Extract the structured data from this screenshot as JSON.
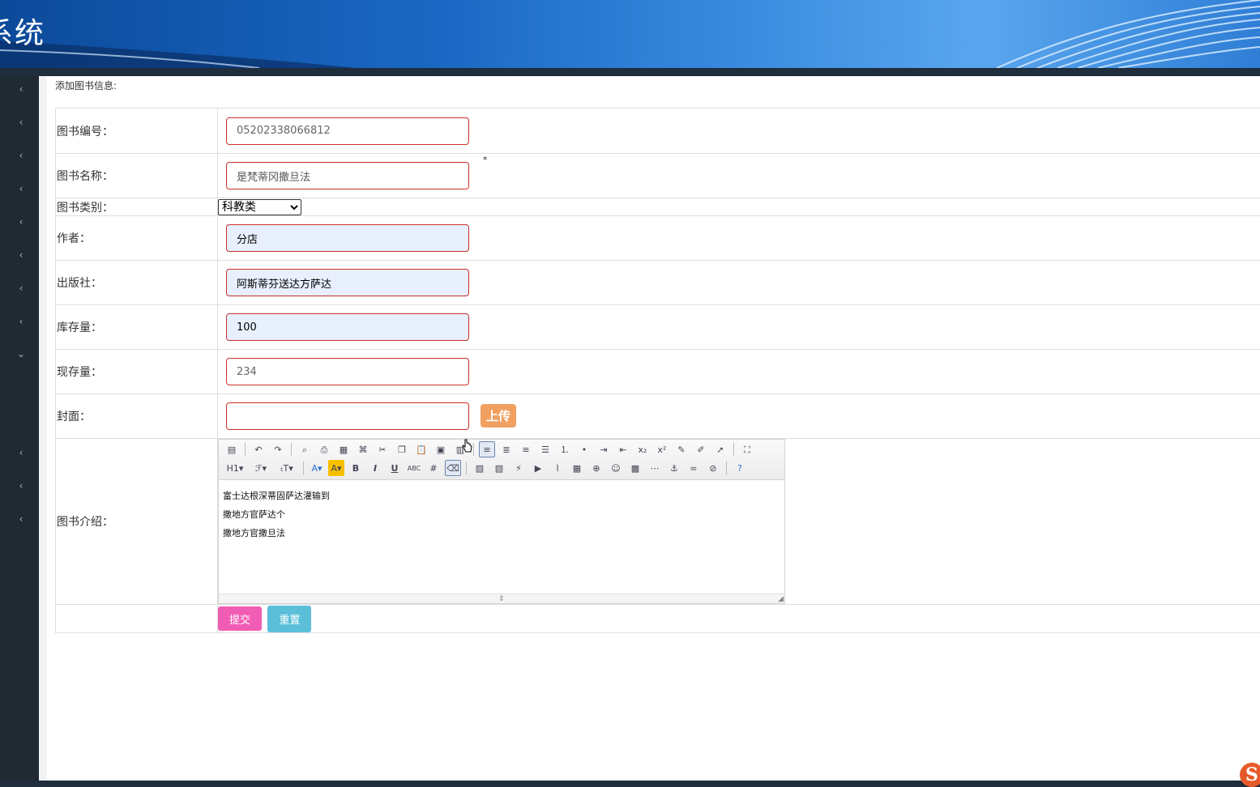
{
  "header": {
    "title": "系统"
  },
  "sidebar": {
    "chevrons": [
      "‹",
      "‹",
      "‹",
      "‹",
      "‹",
      "‹",
      "‹",
      "‹",
      "⌄",
      "‹",
      "‹",
      "‹"
    ]
  },
  "page": {
    "heading": "添加图书信息:"
  },
  "form": {
    "book_no": {
      "label": "图书编号：",
      "value": "05202338066812"
    },
    "book_name": {
      "label": "图书名称：",
      "value": "是梵蒂冈撒旦法",
      "required_mark": "*"
    },
    "category": {
      "label": "图书类别：",
      "selected": "科教类"
    },
    "author": {
      "label": "作者：",
      "value": "分店"
    },
    "publisher": {
      "label": "出版社：",
      "value": "阿斯蒂芬送达方萨达"
    },
    "stock": {
      "label": "库存量：",
      "value": "100"
    },
    "current_stock": {
      "label": "现存量：",
      "value": "234"
    },
    "cover": {
      "label": "封面：",
      "value": "",
      "upload_label": "上传"
    },
    "intro": {
      "label": "图书介绍：",
      "lines": [
        "富士达根深蒂固萨达灌输到",
        "撒地方官萨达个",
        "撒地方官撒旦法"
      ]
    }
  },
  "buttons": {
    "submit": "提交",
    "reset": "重置"
  },
  "toolbar": {
    "row1": [
      "source-icon",
      "undo-icon",
      "redo-icon",
      "preview-icon",
      "print-icon",
      "template-icon",
      "code-icon",
      "cut-icon",
      "copy-icon",
      "paste-icon",
      "paste-text-icon",
      "paste-word-icon",
      "align-left-icon",
      "align-center-icon",
      "align-right-icon",
      "justify-icon",
      "ordered-list-icon",
      "unordered-list-icon",
      "indent-icon",
      "outdent-icon",
      "subscript-icon",
      "superscript-icon",
      "clear-format-icon",
      "select-all-icon",
      "cursor-icon",
      "fullscreen-icon"
    ],
    "row2": [
      "heading-icon",
      "font-family-icon",
      "font-size-icon",
      "font-color-icon",
      "highlight-icon",
      "bold-icon",
      "italic-icon",
      "underline-icon",
      "strikethrough-icon",
      "horizontal-line-icon",
      "remove-format-icon",
      "image-icon",
      "multi-image-icon",
      "flash-icon",
      "media-icon",
      "attachment-icon",
      "table-icon",
      "insert-code-icon",
      "emoticon-icon",
      "map-icon",
      "page-break-icon",
      "anchor-icon",
      "link-icon",
      "unlink-icon",
      "help-icon"
    ],
    "glyphs_row2": {
      "heading-icon": "H1▾",
      "font-family-icon": "ℱ▾",
      "font-size-icon": "ₜT▾",
      "font-color-icon": "A▾",
      "highlight-icon": "A▾",
      "bold-icon": "B",
      "italic-icon": "I",
      "underline-icon": "U",
      "strikethrough-icon": "ABC"
    }
  },
  "colors": {
    "sidebar": "#1f2a33",
    "input_border": "#c9302c",
    "autofill_bg": "#e8f0fe",
    "upload_btn": "#f0a060",
    "submit_btn": "#f15db4",
    "reset_btn": "#5bbfd9"
  }
}
